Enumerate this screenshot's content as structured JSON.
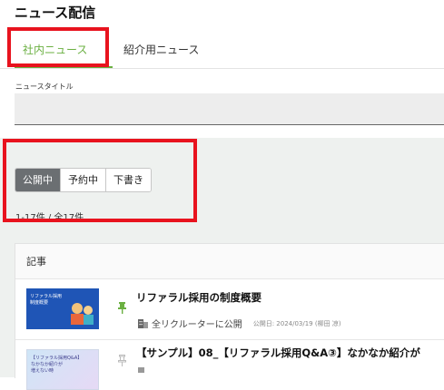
{
  "page_title": "ニュース配信",
  "tabs": [
    {
      "label": "社内ニュース",
      "active": true
    },
    {
      "label": "紹介用ニュース",
      "active": false
    }
  ],
  "colors": {
    "accent": "#6bb042",
    "highlight": "#e8131e",
    "segment_active": "#6b6f72"
  },
  "title_field": {
    "label": "ニュースタイトル",
    "value": "",
    "placeholder": ""
  },
  "status_filter": {
    "options": [
      "公開中",
      "予約中",
      "下書き"
    ],
    "selected": "公開中"
  },
  "result_count": "1-17件 / 全17件",
  "table": {
    "header": "記事",
    "rows": [
      {
        "thumbnail_text": "リファラル採用\n制度概要",
        "pinned": true,
        "title": "リファラル採用の制度概要",
        "audience_icon": "building-icon",
        "audience": "全リクルーターに公開",
        "published": "公開日: 2024/03/19 (柳田 凉)"
      },
      {
        "thumbnail_text": "【リファラル採用Q&A】\nなかなか紹介が\n増えない時",
        "pinned": false,
        "title": "【サンプル】08_【リファラル採用Q&A③】なかなか紹介が",
        "audience_icon": "building-icon",
        "audience": "",
        "published": ""
      }
    ]
  }
}
